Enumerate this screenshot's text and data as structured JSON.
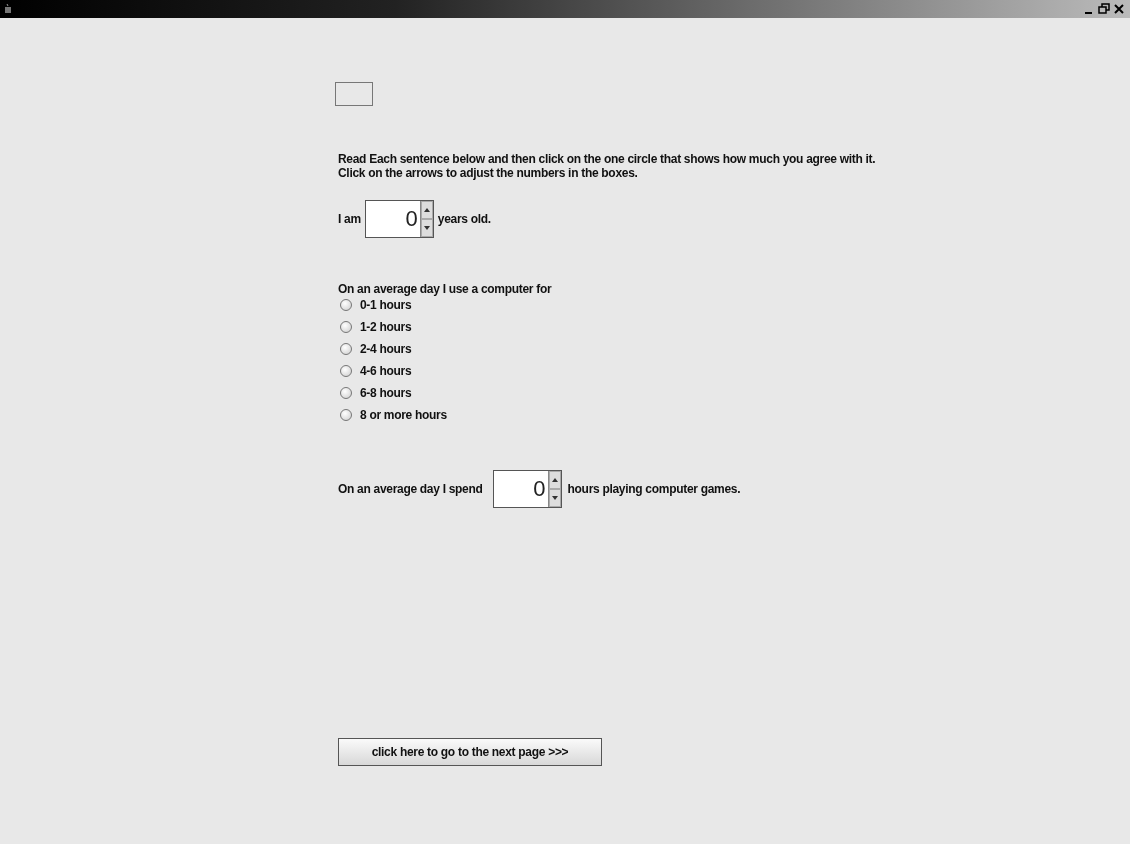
{
  "instructions": "Read Each sentence below and then click on the one circle that shows how much you agree with it. Click on the arrows to adjust the numbers in the boxes.",
  "age": {
    "before": "I am",
    "value": "0",
    "after": "years old."
  },
  "computer_use": {
    "question": "On an average day I use a computer for",
    "options": [
      {
        "label": "0-1 hours",
        "selected": false
      },
      {
        "label": "1-2 hours",
        "selected": false
      },
      {
        "label": "2-4 hours",
        "selected": false
      },
      {
        "label": "4-6 hours",
        "selected": false
      },
      {
        "label": "6-8 hours",
        "selected": false
      },
      {
        "label": "8 or more hours",
        "selected": false
      }
    ]
  },
  "games": {
    "before": "On an average day I spend",
    "value": "0",
    "after": "hours playing computer games."
  },
  "next_button": "click here to go to the next page >>>"
}
